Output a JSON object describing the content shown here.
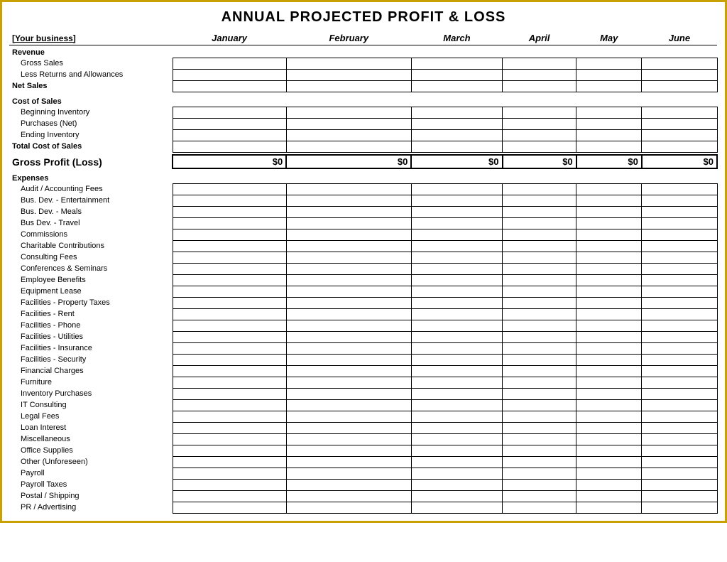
{
  "title": "ANNUAL PROJECTED PROFIT & LOSS",
  "header": {
    "business_label": "[Your business]",
    "months": [
      "January",
      "February",
      "March",
      "April",
      "May",
      "June"
    ]
  },
  "sections": {
    "revenue": {
      "label": "Revenue",
      "rows": [
        {
          "label": "Gross Sales",
          "indent": true
        },
        {
          "label": "Less Returns and Allowances",
          "indent": true
        },
        {
          "label": "Net Sales",
          "indent": false,
          "bold": true
        }
      ]
    },
    "cost_of_sales": {
      "label": "Cost of Sales",
      "rows": [
        {
          "label": "Beginning Inventory",
          "indent": true
        },
        {
          "label": "Purchases (Net)",
          "indent": true
        },
        {
          "label": "Ending Inventory",
          "indent": true
        },
        {
          "label": "Total Cost of Sales",
          "indent": false,
          "bold": true
        }
      ]
    },
    "gross_profit": {
      "label": "Gross Profit (Loss)",
      "value": "$0"
    },
    "expenses": {
      "label": "Expenses",
      "rows": [
        "Audit / Accounting Fees",
        "Bus. Dev. - Entertainment",
        "Bus. Dev. - Meals",
        "Bus Dev. - Travel",
        "Commissions",
        "Charitable Contributions",
        "Consulting Fees",
        "Conferences & Seminars",
        "Employee Benefits",
        "Equipment Lease",
        "Facilities - Property Taxes",
        "Facilities - Rent",
        "Facilities - Phone",
        "Facilities - Utilities",
        "Facilities - Insurance",
        "Facilities - Security",
        "Financial Charges",
        "Furniture",
        "Inventory Purchases",
        "IT Consulting",
        "Legal Fees",
        "Loan Interest",
        "Miscellaneous",
        "Office Supplies",
        "Other (Unforeseen)",
        "Payroll",
        "Payroll Taxes",
        "Postal / Shipping",
        "PR / Advertising"
      ]
    }
  }
}
